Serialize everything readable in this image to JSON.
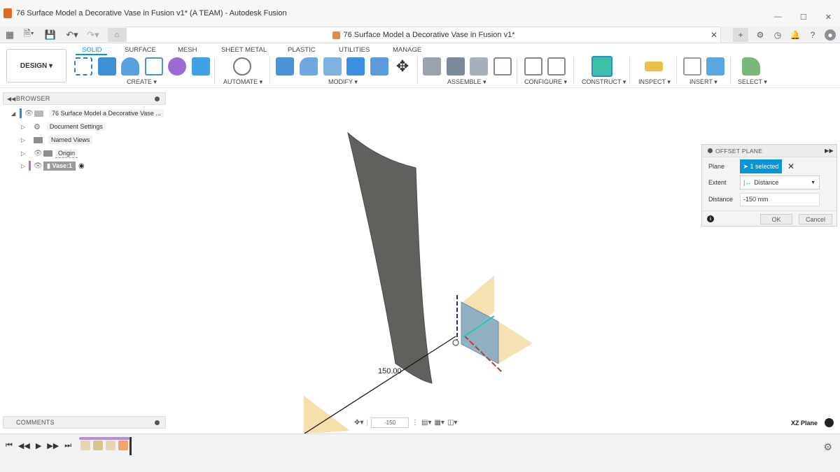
{
  "window": {
    "title": "76 Surface Model a Decorative Vase in Fusion v1* (A TEAM) - Autodesk Fusion",
    "controls": [
      "—",
      "☐",
      "✕"
    ]
  },
  "document_tab": {
    "title": "76 Surface Model a Decorative Vase in Fusion v1*"
  },
  "ribbon": {
    "workspace": "DESIGN",
    "tabs": [
      "SOLID",
      "SURFACE",
      "MESH",
      "SHEET METAL",
      "PLASTIC",
      "UTILITIES",
      "MANAGE"
    ],
    "active_tab": "SOLID",
    "groups": [
      "CREATE",
      "AUTOMATE",
      "MODIFY",
      "ASSEMBLE",
      "CONFIGURE",
      "CONSTRUCT",
      "INSPECT",
      "INSERT",
      "SELECT"
    ],
    "colors": {
      "accent": "#0696d7"
    }
  },
  "browser": {
    "header": "BROWSER",
    "root": "76 Surface Model a Decorative Vase ...",
    "items": [
      {
        "label": "Document Settings",
        "icon": "gear-icon"
      },
      {
        "label": "Named Views",
        "icon": "folder-icon"
      },
      {
        "label": "Origin",
        "icon": "folder-icon"
      },
      {
        "label": "Vase:1",
        "icon": "component-icon"
      }
    ]
  },
  "dialog": {
    "title": "OFFSET PLANE",
    "rows": {
      "plane_label": "Plane",
      "plane_value": "1 selected",
      "extent_label": "Extent",
      "extent_value": "Distance",
      "distance_label": "Distance",
      "distance_value": "-150 mm"
    },
    "ok": "OK",
    "cancel": "Cancel"
  },
  "viewport": {
    "dimension": "150.00",
    "plane_name": "XZ Plane",
    "nav_input": "-150"
  },
  "comments": {
    "header": "COMMENTS"
  }
}
